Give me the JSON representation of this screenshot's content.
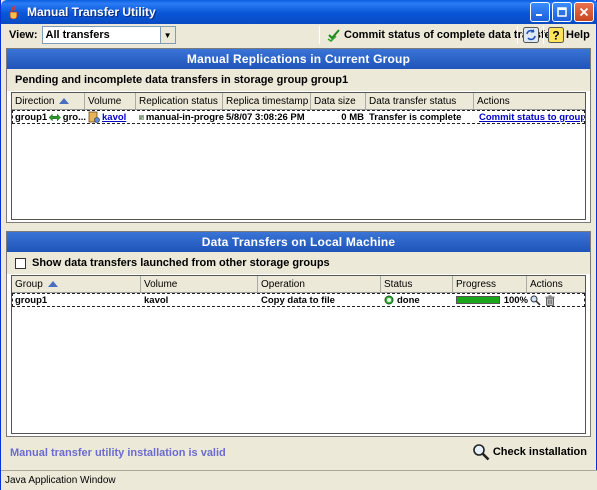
{
  "window": {
    "title": "Manual Transfer Utility"
  },
  "toolbar": {
    "view_label": "View:",
    "view_selected": "All transfers",
    "commit_label": "Commit status of complete data transfers",
    "help_label": "Help"
  },
  "replications": {
    "header": "Manual Replications in Current Group",
    "subtitle": "Pending and incomplete data transfers in storage group group1",
    "columns": [
      "Direction",
      "Volume",
      "Replication status",
      "Replica timestamp",
      "Data size",
      "Data transfer status",
      "Actions"
    ],
    "rows": [
      {
        "direction": "group1",
        "direction_target": "gro...",
        "volume": "kavol",
        "replication_status": "manual-in-progre",
        "replica_timestamp": "5/8/07 3:08:26 PM",
        "data_size": "0 MB",
        "transfer_status": "Transfer is complete",
        "action": "Commit status to group"
      }
    ]
  },
  "local": {
    "header": "Data Transfers on Local Machine",
    "checkbox_label": "Show data transfers launched from other storage groups",
    "checkbox_checked": false,
    "columns": [
      "Group",
      "Volume",
      "Operation",
      "Status",
      "Progress",
      "Actions"
    ],
    "rows": [
      {
        "group": "group1",
        "volume": "kavol",
        "operation": "Copy data to file",
        "status": "done",
        "progress_text": "100%",
        "progress_fraction": 1.0
      }
    ]
  },
  "footer": {
    "valid_msg": "Manual transfer utility installation is valid",
    "check_label": "Check installation",
    "java_label": "Java Application Window"
  },
  "colors": {
    "title_blue": "#0a5fe0",
    "panel_head": "#2a62c8",
    "link": "#0000cc",
    "progress": "#1aa51a",
    "valid_text": "#6b6bd0"
  }
}
